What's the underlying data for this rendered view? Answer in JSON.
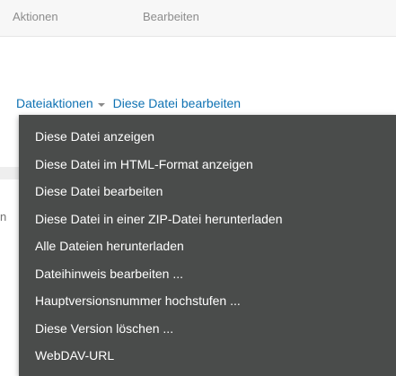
{
  "toolbar": {
    "actions_label": "Aktionen",
    "edit_label": "Bearbeiten"
  },
  "file_actions": {
    "dropdown_label": "Dateiaktionen",
    "edit_file_link": "Diese Datei bearbeiten",
    "caret_icon": "caret-down-icon"
  },
  "background": {
    "partial_glyph": "n"
  },
  "menu": {
    "items": [
      {
        "label": "Diese Datei anzeigen"
      },
      {
        "label": "Diese Datei im HTML-Format anzeigen"
      },
      {
        "label": "Diese Datei bearbeiten"
      },
      {
        "label": "Diese Datei in einer ZIP-Datei herunterladen"
      },
      {
        "label": "Alle Dateien herunterladen"
      },
      {
        "label": "Dateihinweis bearbeiten ..."
      },
      {
        "label": "Hauptversionsnummer hochstufen ..."
      },
      {
        "label": "Diese Version löschen ..."
      },
      {
        "label": "WebDAV-URL"
      }
    ]
  },
  "colors": {
    "link": "#0f72b3",
    "menu_background": "#4a4c4b",
    "menu_text": "#ffffff",
    "toolbar_text": "#8c8c8c"
  }
}
